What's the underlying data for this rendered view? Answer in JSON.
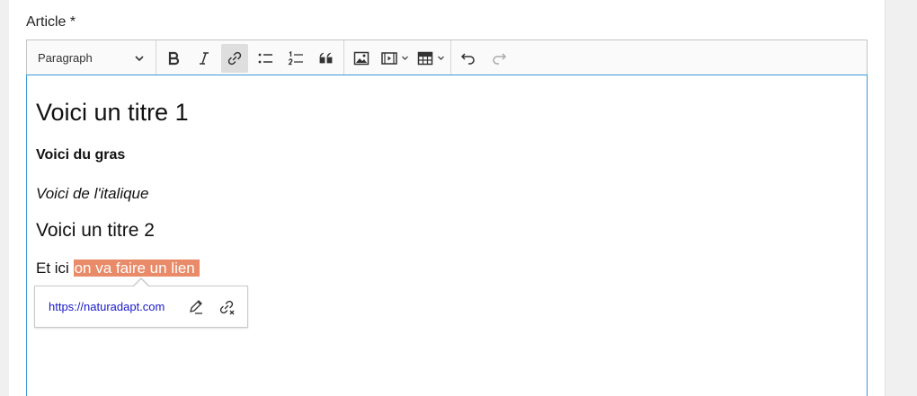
{
  "field": {
    "label": "Article *"
  },
  "toolbar": {
    "heading_select": "Paragraph",
    "buttons": [
      "bold",
      "italic",
      "link",
      "bulleted-list",
      "numbered-list",
      "block-quote",
      "insert-image",
      "insert-media",
      "insert-table",
      "undo",
      "redo"
    ],
    "active_button": "link"
  },
  "content": {
    "heading1": "Voici un titre 1",
    "bold_text": "Voici du gras",
    "italic_text": "Voici de l'italique",
    "heading2": "Voici un titre 2",
    "paragraph_prefix": "Et ici ",
    "link_text": "on va faire un lien "
  },
  "link_balloon": {
    "url": "https://naturadapt.com"
  },
  "colors": {
    "accent_border": "#3d9ad8",
    "link_highlight": "#e98a68",
    "link_url": "#1a1acb"
  }
}
